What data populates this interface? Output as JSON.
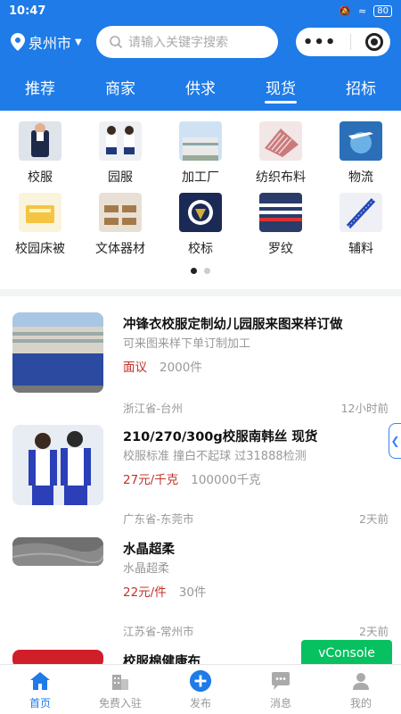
{
  "status": {
    "time": "10:47",
    "battery": "80"
  },
  "header": {
    "city": "泉州市",
    "search_placeholder": "请输入关键字搜索"
  },
  "tabs": [
    {
      "label": "推荐",
      "active": false
    },
    {
      "label": "商家",
      "active": false
    },
    {
      "label": "供求",
      "active": false
    },
    {
      "label": "现货",
      "active": true
    },
    {
      "label": "招标",
      "active": false
    }
  ],
  "categories": [
    {
      "label": "校服",
      "icon": "uniform-icon"
    },
    {
      "label": "园服",
      "icon": "kindergarten-uniform-icon"
    },
    {
      "label": "加工厂",
      "icon": "factory-icon"
    },
    {
      "label": "纺织布料",
      "icon": "fabric-icon"
    },
    {
      "label": "物流",
      "icon": "logistics-icon"
    },
    {
      "label": "校园床被",
      "icon": "bedding-icon"
    },
    {
      "label": "文体器材",
      "icon": "equipment-icon"
    },
    {
      "label": "校标",
      "icon": "badge-icon"
    },
    {
      "label": "罗纹",
      "icon": "rib-fabric-icon"
    },
    {
      "label": "辅料",
      "icon": "accessory-icon"
    }
  ],
  "products": [
    {
      "title": "冲锋衣校服定制幼儿园服来图来样订做",
      "sub": "可来图来样下单订制加工",
      "price": "面议",
      "qty": "2000件",
      "location": "浙江省-台州",
      "time": "12小时前"
    },
    {
      "title": "210/270/300g校服南韩丝 现货",
      "sub": "校服标准 撞白不起球 过31888检测",
      "price": "27元/千克",
      "qty": "100000千克",
      "location": "广东省-东莞市",
      "time": "2天前"
    },
    {
      "title": "水晶超柔",
      "sub": "水晶超柔",
      "price": "22元/件",
      "qty": "30件",
      "location": "江苏省-常州市",
      "time": "2天前"
    },
    {
      "title": "校服棉健康布",
      "sub": "",
      "price": "",
      "qty": "",
      "location": "",
      "time": ""
    }
  ],
  "vconsole": "vConsole",
  "nav": [
    {
      "label": "首页",
      "icon": "home-icon",
      "active": true
    },
    {
      "label": "免费入驻",
      "icon": "building-icon",
      "active": false
    },
    {
      "label": "发布",
      "icon": "plus-circle-icon",
      "active": false
    },
    {
      "label": "消息",
      "icon": "chat-icon",
      "active": false
    },
    {
      "label": "我的",
      "icon": "user-icon",
      "active": false
    }
  ]
}
